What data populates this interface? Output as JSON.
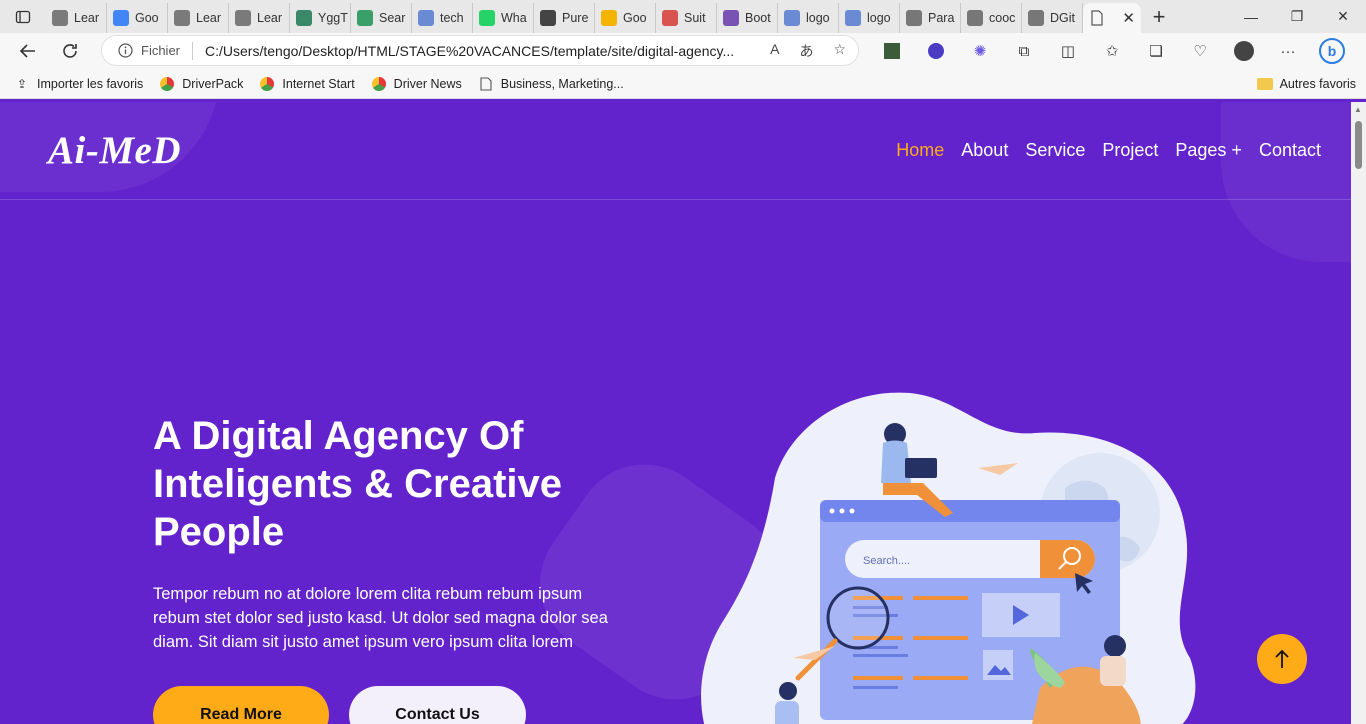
{
  "browser": {
    "tabs": [
      {
        "label": "Lear",
        "icon": "ai-icon",
        "color": "#7a7a7a"
      },
      {
        "label": "Goo",
        "icon": "google-translate-icon",
        "color": "#4285f4"
      },
      {
        "label": "Lear",
        "icon": "ai-icon",
        "color": "#7a7a7a"
      },
      {
        "label": "Lear",
        "icon": "ai-icon",
        "color": "#7a7a7a"
      },
      {
        "label": "YggT",
        "icon": "ygg-icon",
        "color": "#3a8a6a"
      },
      {
        "label": "Sear",
        "icon": "search-icon",
        "color": "#3aa06a"
      },
      {
        "label": "tech",
        "icon": "search-icon",
        "color": "#6a8ad4"
      },
      {
        "label": "Wha",
        "icon": "whatsapp-icon",
        "color": "#25d366"
      },
      {
        "label": "Pure",
        "icon": "github-icon",
        "color": "#444444"
      },
      {
        "label": "Goo",
        "icon": "drive-icon",
        "color": "#f4b400"
      },
      {
        "label": "Suit",
        "icon": "pdf-icon",
        "color": "#d9534f"
      },
      {
        "label": "Boot",
        "icon": "bootstrap-icon",
        "color": "#7952b3"
      },
      {
        "label": "logo",
        "icon": "search-icon",
        "color": "#6a8ad4"
      },
      {
        "label": "logo",
        "icon": "search-icon",
        "color": "#6a8ad4"
      },
      {
        "label": "Para",
        "icon": "settings-icon",
        "color": "#777777"
      },
      {
        "label": "cooc",
        "icon": "document-icon",
        "color": "#777777"
      },
      {
        "label": "DGit",
        "icon": "document-icon",
        "color": "#777777"
      }
    ],
    "address": {
      "scheme_label": "Fichier",
      "url": "C:/Users/tengo/Desktop/HTML/STAGE%20VACANCES/template/site/digital-agency..."
    },
    "favorites": [
      {
        "label": "Importer les favoris",
        "icon": "import-icon"
      },
      {
        "label": "DriverPack",
        "icon": "driverpack-icon"
      },
      {
        "label": "Internet Start",
        "icon": "driverpack-icon"
      },
      {
        "label": "Driver News",
        "icon": "driverpack-icon"
      },
      {
        "label": "Business, Marketing...",
        "icon": "document-icon"
      }
    ],
    "other_favorites": "Autres favoris"
  },
  "site": {
    "logo": "Ai-MeD",
    "nav": [
      "Home",
      "About",
      "Service",
      "Project",
      "Pages +",
      "Contact"
    ],
    "active_nav": "Home",
    "hero": {
      "title": "A Digital Agency Of Inteligents & Creative People",
      "text": "Tempor rebum no at dolore lorem clita rebum rebum ipsum rebum stet dolor sed justo kasd. Ut dolor sed magna dolor sea diam. Sit diam sit justo amet ipsum vero ipsum clita lorem",
      "primary_button": "Read More",
      "secondary_button": "Contact Us"
    },
    "illustration": {
      "search_placeholder": "Search...."
    },
    "colors": {
      "background": "#6222cc",
      "accent": "#ffaa17",
      "text": "#ffffff"
    }
  }
}
